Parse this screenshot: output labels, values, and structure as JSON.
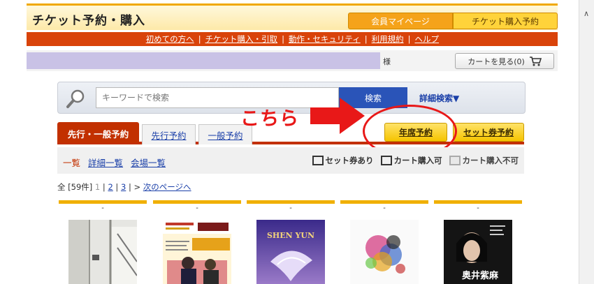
{
  "header": {
    "title": "チケット予約・購入",
    "tab_member": "会員マイページ",
    "tab_purchase": "チケット購入予約"
  },
  "nav": {
    "links": [
      "初めての方へ",
      "チケット購入・引取",
      "動作・セキュリティ",
      "利用規約",
      "ヘルプ"
    ],
    "sep": "|"
  },
  "user": {
    "honorific": "様",
    "cart_label": "カートを見る(0)"
  },
  "search": {
    "placeholder": "キーワードで検索",
    "button": "検索",
    "advanced": "詳細検索▼"
  },
  "annotation": {
    "text": "こちら"
  },
  "tabs": {
    "main": "先行・一般予約",
    "pre": "先行予約",
    "general": "一般予約",
    "season": "年席予約",
    "set": "セット券予約"
  },
  "views": {
    "list": "一覧",
    "detail": "詳細一覧",
    "venue": "会場一覧"
  },
  "legend": {
    "set": "セット券あり",
    "cart_ok": "カート購入可",
    "cart_ng": "カート購入不可"
  },
  "pager": {
    "total": "全 [59件]",
    "p1": "1",
    "p2": "2",
    "p3": "3",
    "next": "次のページへ"
  },
  "cards": [
    {
      "label": "-",
      "image": "building-photo"
    },
    {
      "label": "-",
      "image": "new-year-concert-poster"
    },
    {
      "label": "-",
      "image": "shen-yun-poster",
      "poster_title": "SHEN YUN"
    },
    {
      "label": "-",
      "image": "floral-artwork"
    },
    {
      "label": "-",
      "image": "portrait-poster",
      "poster_name": "奥井紫麻"
    }
  ],
  "colors": {
    "accent": "#c23000",
    "nav": "#d9430a",
    "yellow": "#f5c400",
    "link": "#1a3fa8",
    "annot": "#e81818"
  }
}
